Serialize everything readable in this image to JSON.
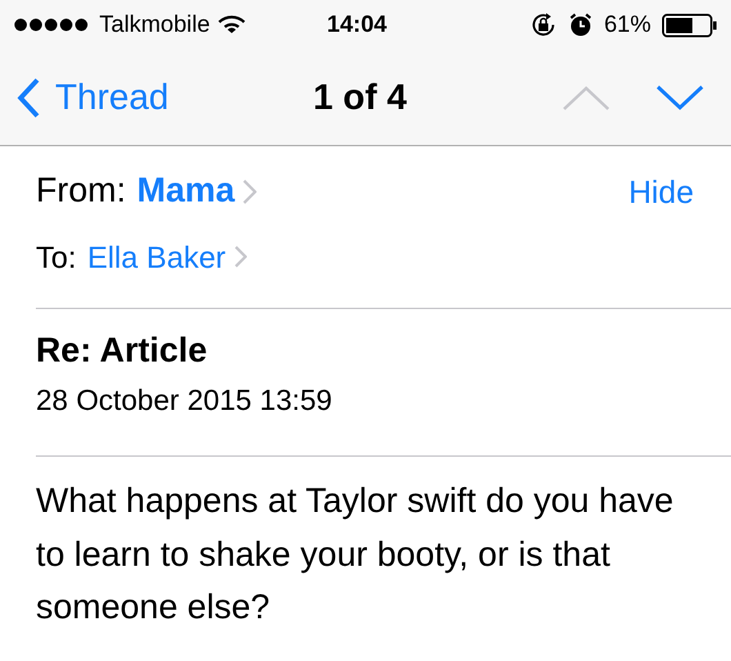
{
  "status_bar": {
    "carrier": "Talkmobile",
    "time": "14:04",
    "battery": "61%"
  },
  "nav": {
    "back": "Thread",
    "title": "1 of 4",
    "up_disabled": true,
    "down_disabled": false
  },
  "header": {
    "from_label": "From:",
    "from": "Mama",
    "hide": "Hide",
    "to_label": "To:",
    "to": "Ella Baker"
  },
  "subject": "Re: Article",
  "date": "28 October 2015 13:59",
  "body": "What happens at Taylor swift do you have to learn to shake your booty, or is that someone else?"
}
